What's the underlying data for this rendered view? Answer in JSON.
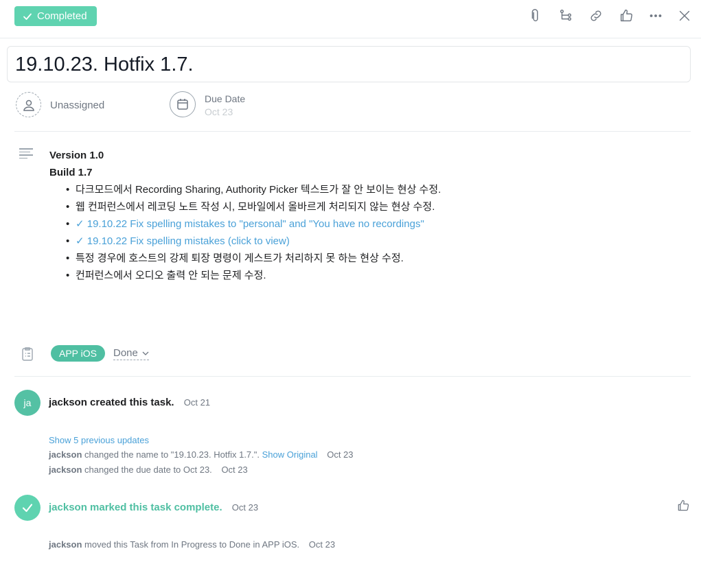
{
  "header": {
    "completed_label": "Completed",
    "icons": [
      "attachment-icon",
      "subtask-icon",
      "link-icon",
      "like-icon",
      "more-icon",
      "close-icon"
    ]
  },
  "task": {
    "title": "19.10.23. Hotfix 1.7.",
    "assignee": "Unassigned",
    "due_label": "Due Date",
    "due_value": "Oct 23"
  },
  "description": {
    "heading1": "Version 1.0",
    "heading2": "Build 1.7",
    "items": [
      "다크모드에서 Recording Sharing, Authority Picker 텍스트가 잘 안 보이는 현상 수정.",
      "웹 컨퍼런스에서 레코딩 노트 작성 시, 모바일에서 올바르게 처리되지 않는 현상 수정.",
      "✓ 19.10.22 Fix spelling mistakes to \"personal\" and \"You have no recordings\"",
      "✓ 19.10.22 Fix spelling mistakes (click to view)",
      "특정 경우에 호스트의 강제 퇴장 명령이 게스트가 처리하지 못 하는 현상 수정.",
      "컨퍼런스에서 오디오 출력 안 되는 문제 수정."
    ]
  },
  "project": {
    "name": "APP iOS",
    "section": "Done"
  },
  "activity": {
    "avatar_initials": "ja",
    "created_user": "jackson",
    "created_text": "created this task.",
    "created_time": "Oct 21",
    "show_previous": "Show 5 previous updates",
    "update1_user": "jackson",
    "update1_text": "changed the name to \"19.10.23. Hotfix 1.7.\".",
    "update1_link": "Show Original",
    "update1_time": "Oct 23",
    "update2_user": "jackson",
    "update2_text": "changed the due date to Oct 23.",
    "update2_time": "Oct 23",
    "complete_text": "jackson marked this task complete.",
    "complete_time": "Oct 23",
    "moved_user": "jackson",
    "moved_text": "moved this Task from In Progress to Done in APP iOS.",
    "moved_time": "Oct 23"
  },
  "colors": {
    "accent_green": "#5fd3b0",
    "pill_green": "#4fbfa2",
    "link_blue": "#4aa1d8"
  }
}
